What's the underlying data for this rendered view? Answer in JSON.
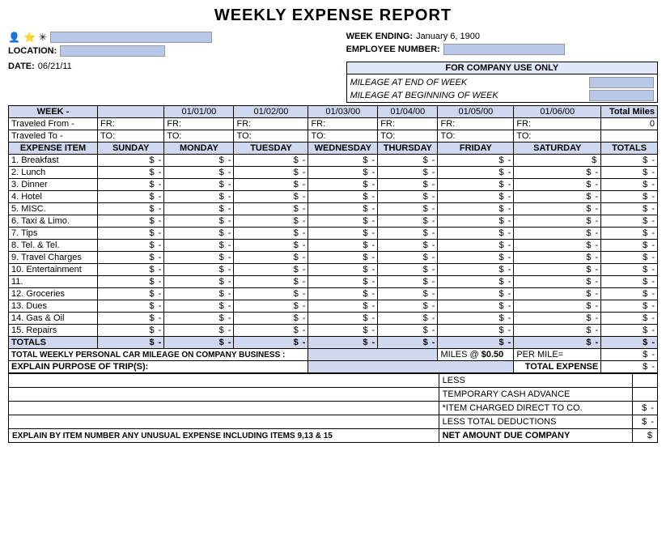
{
  "title": "WEEKLY EXPENSE REPORT",
  "header": {
    "week_ending_label": "WEEK ENDING:",
    "week_ending_value": "January 6, 1900",
    "employee_number_label": "EMPLOYEE NUMBER:",
    "location_label": "LOCATION:",
    "date_label": "DATE:",
    "date_value": "06/21/11",
    "for_company_car": "FOR COMPANY USE ONLY",
    "mileage_end": "MILEAGE AT END OF WEEK",
    "mileage_begin": "MILEAGE AT BEGINNING OF WEEK"
  },
  "week_row": {
    "label": "WEEK -",
    "dates": [
      "01/01/00",
      "01/02/00",
      "01/03/00",
      "01/04/00",
      "01/05/00",
      "01/06/00"
    ],
    "total_miles": "Total Miles",
    "total_miles_value": "0"
  },
  "travel_row": {
    "from_label": "Traveled From -",
    "to_label": "Traveled To -",
    "fr": "FR:",
    "to": "TO:"
  },
  "columns": {
    "item": "EXPENSE ITEM",
    "days": [
      "SUNDAY",
      "MONDAY",
      "TUESDAY",
      "WEDNESDAY",
      "THURSDAY",
      "FRIDAY",
      "SATURDAY"
    ],
    "total": "TOTALS"
  },
  "expense_items": [
    "1. Breakfast",
    "2. Lunch",
    "3. Dinner",
    "4. Hotel",
    "5. MISC.",
    "6. Taxi & Limo.",
    "7. Tips",
    "8. Tel. & Tel.",
    "9. Travel Charges",
    "10. Entertainment",
    "11.",
    "12. Groceries",
    "13. Dues",
    "14. Gas & Oil",
    "15. Repairs",
    "TOTALS"
  ],
  "mileage": {
    "label": "TOTAL WEEKLY PERSONAL CAR MILEAGE ON COMPANY BUSINESS :",
    "miles_at": "MILES @",
    "rate": "$0.50",
    "per_mile": "PER MILE="
  },
  "explain": {
    "label": "EXPLAIN PURPOSE OF TRIP(S):",
    "total_expense_label": "TOTAL EXPENSE"
  },
  "summary": {
    "less": "LESS",
    "temp_cash": "TEMPORARY CASH ADVANCE",
    "item_charged": "*ITEM CHARGED DIRECT TO CO.",
    "less_total": "LESS TOTAL DEDUCTIONS",
    "net_amount": "NET AMOUNT DUE COMPANY",
    "explain_unusual": "EXPLAIN BY ITEM NUMBER ANY UNUSUAL EXPENSE INCLUDING ITEMS 9,13 & 15"
  }
}
